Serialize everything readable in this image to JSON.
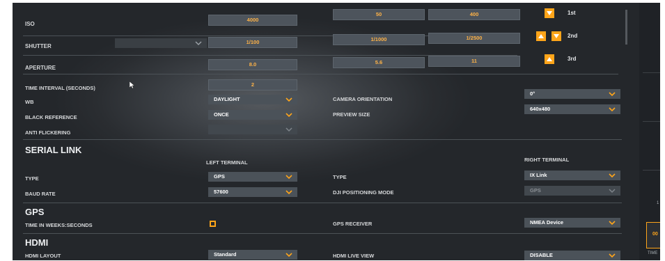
{
  "exposure": {
    "iso": {
      "label": "ISO",
      "value": "4000",
      "min": "50",
      "max": "400"
    },
    "shutter": {
      "label": "SHUTTER",
      "value": "1/100",
      "min": "1/1000",
      "max": "1/2500"
    },
    "aperture": {
      "label": "APERTURE",
      "value": "8.0",
      "min": "5.6",
      "max": "11"
    },
    "priority": {
      "first": "1st",
      "second": "2nd",
      "third": "3rd"
    }
  },
  "camera": {
    "time_interval": {
      "label": "TIME INTERVAL (Seconds)",
      "value": "2"
    },
    "wb": {
      "label": "WB",
      "value": "DAYLIGHT"
    },
    "black_reference": {
      "label": "BLACK REFERENCE",
      "value": "ONCE"
    },
    "anti_flickering": {
      "label": "ANTI FLICKERING",
      "value": ""
    },
    "camera_orientation": {
      "label": "CAMERA ORIENTATION",
      "value": "0°"
    },
    "preview_size": {
      "label": "PREVIEW SIZE",
      "value": "640x480"
    }
  },
  "serial_link": {
    "title": "SERIAL LINK",
    "left_terminal": "LEFT TERMINAL",
    "right_terminal": "RIGHT TERMINAL",
    "left_type": {
      "label": "TYPE",
      "value": "GPS"
    },
    "baud_rate": {
      "label": "BAUD RATE",
      "value": "57600"
    },
    "right_type": {
      "label": "TYPE",
      "value": "IX Link"
    },
    "dji_mode": {
      "label": "DJI POSITIONING MODE",
      "value": "GPS"
    }
  },
  "gps": {
    "title": "GPS",
    "time_in_weeks": {
      "label": "TIME IN WEEKS:SECONDS",
      "checked": false
    },
    "gps_receiver": {
      "label": "GPS RECEIVER",
      "value": "NMEA Device"
    }
  },
  "hdmi": {
    "title": "HDMI",
    "layout": {
      "label": "HDMI LAYOUT",
      "value": "Standard"
    },
    "live_view": {
      "label": "HDMI LIVE VIEW",
      "value": "DISABLE"
    }
  },
  "right_panel": {
    "bottom_label": "TIME",
    "box_text": "00",
    "side_digit": "1"
  },
  "colors": {
    "accent": "#ffa51a",
    "value_text": "#ffb347",
    "background": "#2a2d31"
  },
  "icons": {
    "chevron": "chevron-down-icon",
    "up": "arrow-up-icon",
    "down": "arrow-down-icon"
  }
}
